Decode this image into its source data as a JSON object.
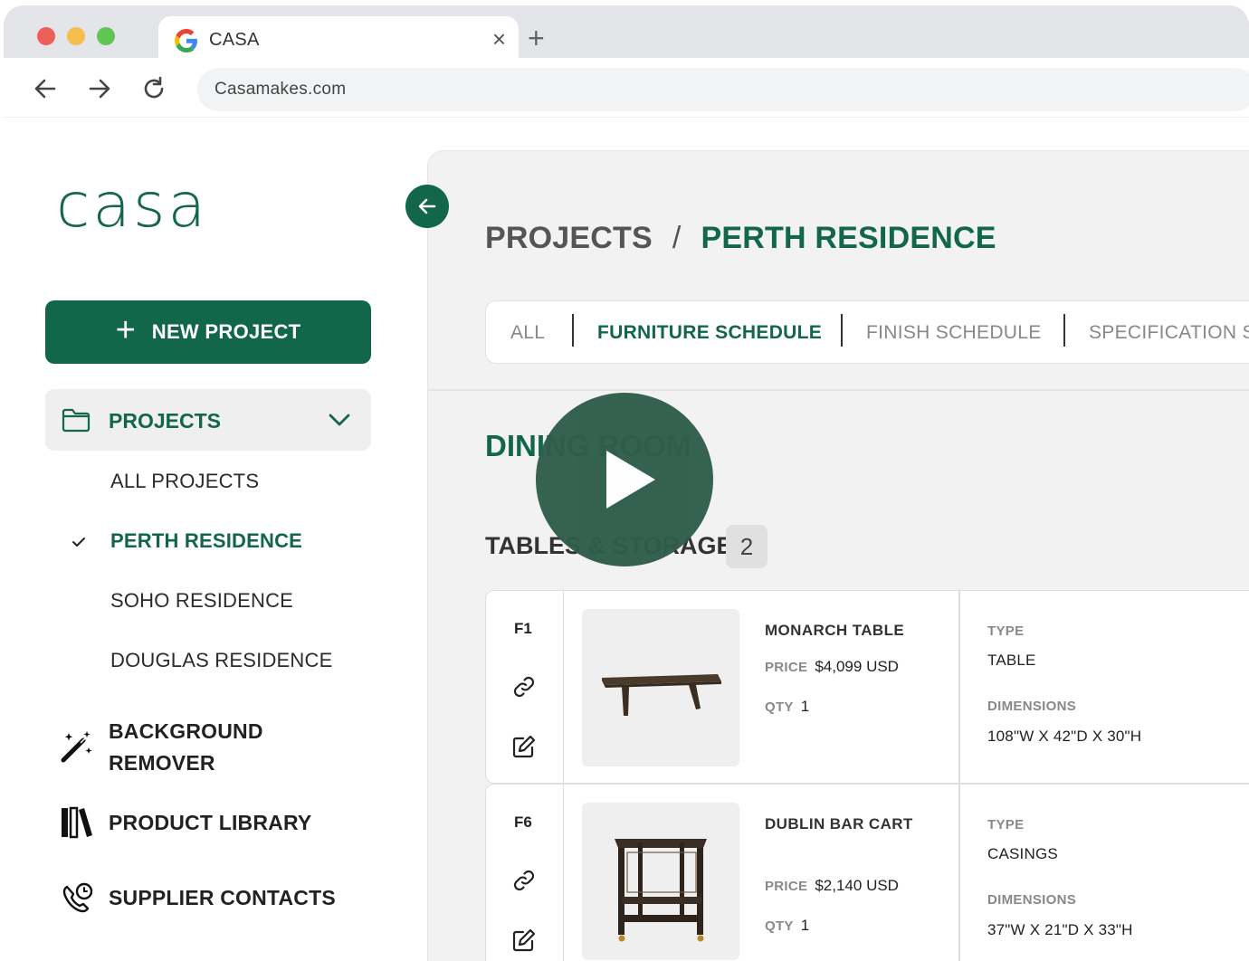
{
  "browser": {
    "tab_title": "CASA",
    "url": "Casamakes.com"
  },
  "colors": {
    "brand": "#12664a",
    "play_overlay": "#2f5d4c"
  },
  "sidebar": {
    "logo": "casa",
    "new_project": "NEW PROJECT",
    "projects_label": "PROJECTS",
    "projects": [
      {
        "label": "ALL PROJECTS",
        "active": false
      },
      {
        "label": "PERTH RESIDENCE",
        "active": true
      },
      {
        "label": "SOHO RESIDENCE",
        "active": false
      },
      {
        "label": "DOUGLAS RESIDENCE",
        "active": false
      }
    ],
    "tools": [
      {
        "label_line1": "BACKGROUND",
        "label_line2": "REMOVER",
        "icon": "magic-wand-icon"
      },
      {
        "label": "PRODUCT LIBRARY",
        "icon": "library-icon"
      },
      {
        "label": "SUPPLIER CONTACTS",
        "icon": "phone-icon"
      }
    ]
  },
  "main": {
    "breadcrumb": {
      "root": "PROJECTS",
      "separator": "/",
      "current": "PERTH RESIDENCE"
    },
    "tabs": [
      "ALL",
      "FURNITURE SCHEDULE",
      "FINISH SCHEDULE",
      "SPECIFICATION S"
    ],
    "active_tab": "FURNITURE SCHEDULE",
    "room": "DINING ROOM",
    "group": {
      "title": "TABLES & STORAGE",
      "count": "2"
    },
    "items": [
      {
        "code": "F1",
        "name": "MONARCH TABLE",
        "price_label": "PRICE",
        "price": "$4,099 USD",
        "qty_label": "QTY",
        "qty": "1",
        "type_label": "TYPE",
        "type": "TABLE",
        "dim_label": "DIMENSIONS",
        "dimensions": "108\"W X 42\"D X 30\"H"
      },
      {
        "code": "F6",
        "name": "DUBLIN BAR CART",
        "price_label": "PRICE",
        "price": "$2,140 USD",
        "qty_label": "QTY",
        "qty": "1",
        "type_label": "TYPE",
        "type": "CASINGS",
        "dim_label": "DIMENSIONS",
        "dimensions": "37\"W X 21\"D X 33\"H"
      }
    ]
  }
}
